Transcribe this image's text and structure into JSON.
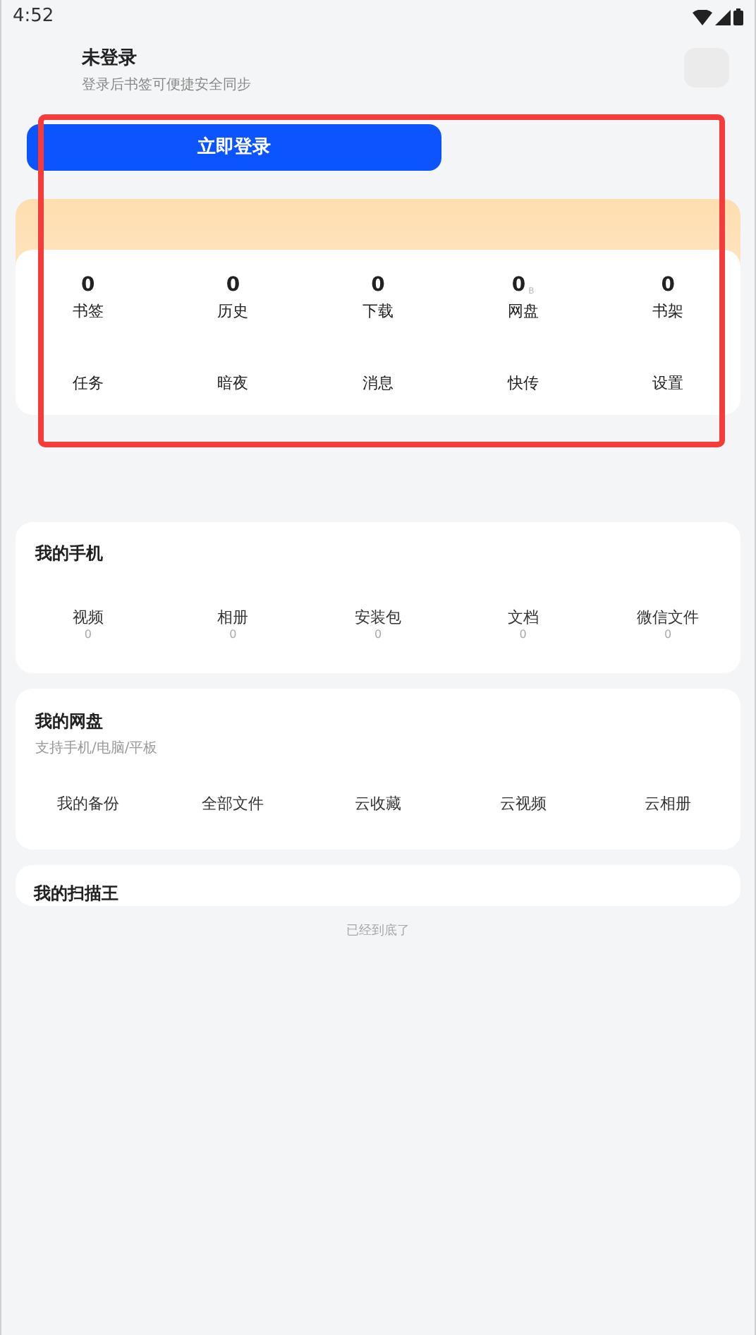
{
  "status_bar": {
    "time": "4:52"
  },
  "profile": {
    "name": "未登录",
    "subtitle": "登录后书签可便捷安全同步"
  },
  "login_button": {
    "label": "立即登录"
  },
  "stats": [
    {
      "value": "0",
      "label": "书签"
    },
    {
      "value": "0",
      "label": "历史"
    },
    {
      "value": "0",
      "label": "下载"
    },
    {
      "value": "0",
      "unit": "B",
      "label": "网盘"
    },
    {
      "value": "0",
      "label": "书架"
    }
  ],
  "shortcuts": [
    "任务",
    "暗夜",
    "消息",
    "快传",
    "设置"
  ],
  "my_phone": {
    "title": "我的手机",
    "items": [
      {
        "label": "视频",
        "count": "0"
      },
      {
        "label": "相册",
        "count": "0"
      },
      {
        "label": "安装包",
        "count": "0"
      },
      {
        "label": "文档",
        "count": "0"
      },
      {
        "label": "微信文件",
        "count": "0"
      }
    ]
  },
  "my_netdisk": {
    "title": "我的网盘",
    "subtitle": "支持手机/电脑/平板",
    "items": [
      "我的备份",
      "全部文件",
      "云收藏",
      "云视频",
      "云相册"
    ]
  },
  "my_scanner": {
    "title": "我的扫描王"
  },
  "footer": "已经到底了"
}
